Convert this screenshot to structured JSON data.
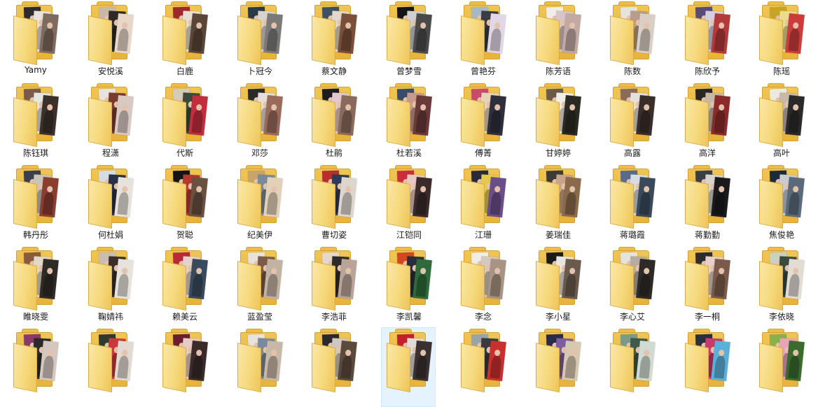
{
  "explorer": {
    "view": "large-icons",
    "selected_index": 49,
    "folders": [
      {
        "name": "Yamy",
        "photos": [
          "#2c2c30",
          "#e9e2da",
          "#7e6a5e"
        ]
      },
      {
        "name": "安悦溪",
        "photos": [
          "#c9b8a8",
          "#2e2a28",
          "#e8d6c8"
        ]
      },
      {
        "name": "白鹿",
        "photos": [
          "#9c2a2a",
          "#e8dfd4",
          "#5a4638"
        ]
      },
      {
        "name": "卜冠今",
        "photos": [
          "#2b3a48",
          "#d7d3cf",
          "#7c7a78"
        ]
      },
      {
        "name": "蔡文静",
        "photos": [
          "#3d5163",
          "#e0d8cc",
          "#7a4f3a"
        ]
      },
      {
        "name": "曾梦雪",
        "photos": [
          "#151515",
          "#cfcfcf",
          "#4a4a4a"
        ]
      },
      {
        "name": "曾艳芬",
        "photos": [
          "#a7b8c4",
          "#3a3c44",
          "#e2d7e6"
        ]
      },
      {
        "name": "陈芳语",
        "photos": [
          "#f2ecea",
          "#d6c6c8",
          "#c3a9a4"
        ]
      },
      {
        "name": "陈数",
        "photos": [
          "#e7e2dc",
          "#b89c8c",
          "#d9cfc4"
        ]
      },
      {
        "name": "陈欣予",
        "photos": [
          "#5a4c7a",
          "#d5d0e0",
          "#b23a3a"
        ]
      },
      {
        "name": "陈瑶",
        "photos": [
          "#c7a425",
          "#e9dc8a",
          "#cc3c3c"
        ]
      },
      {
        "name": "陈钰琪",
        "photos": [
          "#7a5a4a",
          "#e3e7e0",
          "#3b302a"
        ]
      },
      {
        "name": "程潇",
        "photos": [
          "#e9e2de",
          "#7a3b2e",
          "#d8c9c2"
        ]
      },
      {
        "name": "代斯",
        "photos": [
          "#d6cbb8",
          "#3a4a3a",
          "#c12e3e"
        ]
      },
      {
        "name": "邓莎",
        "photos": [
          "#2a2a2a",
          "#e6dfd9",
          "#9a6a5a"
        ]
      },
      {
        "name": "杜鹃",
        "photos": [
          "#1c1c20",
          "#e4c8d0",
          "#8a6a5a"
        ]
      },
      {
        "name": "杜若溪",
        "photos": [
          "#3a4a6a",
          "#c79a8a",
          "#6a3a3a"
        ]
      },
      {
        "name": "傅菁",
        "photos": [
          "#c94a6a",
          "#e9d3b8",
          "#2e2e3e"
        ]
      },
      {
        "name": "甘婷婷",
        "photos": [
          "#6a5a4a",
          "#f2ede6",
          "#2a2a24"
        ]
      },
      {
        "name": "高露",
        "photos": [
          "#8a6a5a",
          "#e6e0da",
          "#3a2e2a"
        ]
      },
      {
        "name": "高洋",
        "photos": [
          "#2a2624",
          "#c9b8a4",
          "#8a2a2a"
        ]
      },
      {
        "name": "高叶",
        "photos": [
          "#ece8e2",
          "#c8b8a8",
          "#2a2a2a"
        ]
      },
      {
        "name": "韩丹彤",
        "photos": [
          "#3a3e4e",
          "#c9c3bc",
          "#8a3e30"
        ]
      },
      {
        "name": "何杜娟",
        "photos": [
          "#d6dce4",
          "#2a3046",
          "#e8e2dc"
        ]
      },
      {
        "name": "贺聪",
        "photos": [
          "#141414",
          "#b33a2e",
          "#6a5040"
        ]
      },
      {
        "name": "纪美伊",
        "photos": [
          "#c8a46a",
          "#7a8a9a",
          "#e2d0b8"
        ]
      },
      {
        "name": "曹切姿",
        "photos": [
          "#b82e2e",
          "#2e3a5a",
          "#ddd6cc"
        ]
      },
      {
        "name": "江铠同",
        "photos": [
          "#c92e3a",
          "#e8c8c0",
          "#3a2a2a"
        ]
      },
      {
        "name": "江珊",
        "photos": [
          "#2a2a3a",
          "#e6c84a",
          "#6a4e8a"
        ]
      },
      {
        "name": "姜瑞佳",
        "photos": [
          "#3e3a36",
          "#c8a48a",
          "#8a6a4a"
        ]
      },
      {
        "name": "蒋璐霞",
        "photos": [
          "#5a6a8a",
          "#d6dce4",
          "#3a4a5a"
        ]
      },
      {
        "name": "蒋勤勤",
        "photos": [
          "#3a3e46",
          "#d9d3cc",
          "#1a1a1c"
        ]
      },
      {
        "name": "焦俊艳",
        "photos": [
          "#1c2a3a",
          "#c8ccd0",
          "#5a6a7a"
        ]
      },
      {
        "name": "睢晓雯",
        "photos": [
          "#8a5a3e",
          "#e2d8ca",
          "#2e2a26"
        ]
      },
      {
        "name": "鞠婧祎",
        "photos": [
          "#c9bcb2",
          "#3a2e2a",
          "#e8e2dc"
        ]
      },
      {
        "name": "赖美云",
        "photos": [
          "#b82a36",
          "#e6d2cc",
          "#3a4a5e"
        ]
      },
      {
        "name": "蓝盈莹",
        "photos": [
          "#e9e2dc",
          "#7a5a48",
          "#c2b2a4"
        ]
      },
      {
        "name": "李浩菲",
        "photos": [
          "#e6d6cc",
          "#2e2a2a",
          "#b8a498"
        ]
      },
      {
        "name": "李凯馨",
        "photos": [
          "#d2471e",
          "#2a2e3a",
          "#2e6a3a"
        ]
      },
      {
        "name": "李念",
        "photos": [
          "#f2ece6",
          "#d6c8bc",
          "#a89484"
        ]
      },
      {
        "name": "李小星",
        "photos": [
          "#1a1a1a",
          "#e9e6e2",
          "#6a5a4e"
        ]
      },
      {
        "name": "李心艾",
        "photos": [
          "#e6e2de",
          "#b8aca2",
          "#2e2a28"
        ]
      },
      {
        "name": "李一桐",
        "photos": [
          "#2e2a30",
          "#e6d0c8",
          "#7a5a4a"
        ]
      },
      {
        "name": "李依晓",
        "photos": [
          "#c8d0c4",
          "#3a4a3e",
          "#e2dcd4"
        ]
      },
      {
        "name": "",
        "photos": [
          "#8a3a6a",
          "#2a2a2a",
          "#d6c6c0"
        ]
      },
      {
        "name": "",
        "photos": [
          "#2e3a2e",
          "#c83a3a",
          "#e2dad2"
        ]
      },
      {
        "name": "",
        "photos": [
          "#6a1e2e",
          "#e6ccc4",
          "#3a2a2a"
        ]
      },
      {
        "name": "",
        "photos": [
          "#e6e2dc",
          "#7a8a9e",
          "#c8b8a8"
        ]
      },
      {
        "name": "",
        "photos": [
          "#2a2a2e",
          "#cfc8c0",
          "#5a4a3e"
        ]
      },
      {
        "name": "",
        "photos": [
          "#c2202a",
          "#e2dad4",
          "#3a3030"
        ]
      },
      {
        "name": "",
        "photos": [
          "#9aa4a8",
          "#3a3a3e",
          "#c8302e"
        ]
      },
      {
        "name": "",
        "photos": [
          "#2a2a4a",
          "#7a5ea0",
          "#d8c8b0"
        ]
      },
      {
        "name": "",
        "photos": [
          "#7a9a8a",
          "#3e5a4a",
          "#d0dcd2"
        ]
      },
      {
        "name": "",
        "photos": [
          "#2a2e3e",
          "#c83a6a",
          "#5ab0d8"
        ]
      },
      {
        "name": "",
        "photos": [
          "#8ab04a",
          "#e6a4b8",
          "#3a6a2e"
        ]
      }
    ]
  },
  "colors": {
    "folder_back": "#f0c553",
    "folder_front": "#f6d97c",
    "selection_bg": "#e5f3ff",
    "selection_border": "#cce8ff",
    "label_text": "#1a1a1a"
  }
}
